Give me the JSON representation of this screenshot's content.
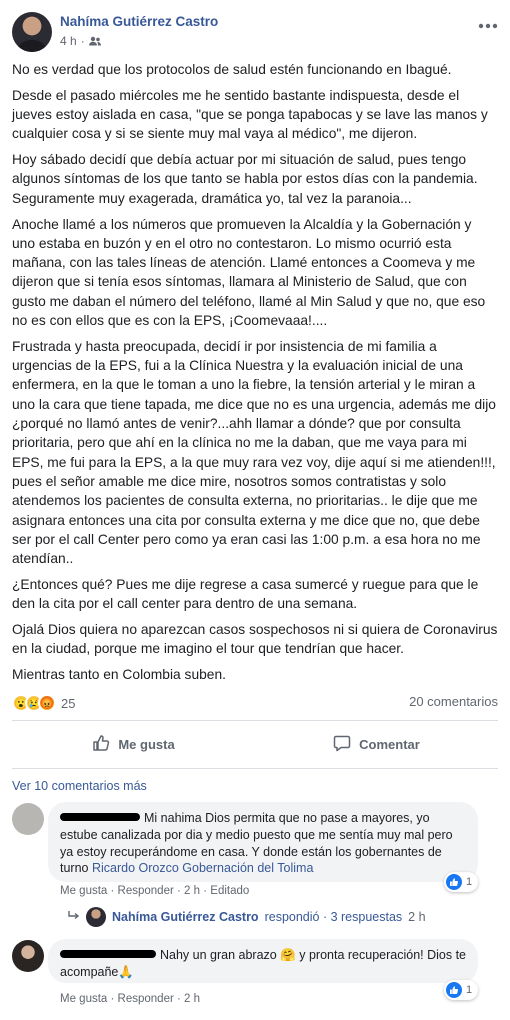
{
  "post": {
    "author": "Nahíma Gutiérrez Castro",
    "time": "4 h",
    "paragraphs": [
      "No es verdad que los protocolos de salud estén funcionando en Ibagué.",
      "Desde el pasado miércoles me he sentido bastante indispuesta, desde el jueves estoy aislada en casa, \"que se ponga tapabocas y se lave las manos y cualquier cosa y si se siente muy mal vaya al médico\", me dijeron.",
      "Hoy sábado decidí que debía actuar por mi situación de salud, pues tengo algunos síntomas de los que tanto se habla por estos días con la pandemia. Seguramente muy exagerada, dramática yo, tal vez la paranoia...",
      "Anoche llamé a los números que promueven la Alcaldía y la Gobernación y uno estaba en buzón y en el otro no contestaron. Lo mismo ocurrió esta mañana, con las tales líneas de atención. Llamé entonces a Coomeva y me dijeron que si tenía esos síntomas, llamara al Ministerio de Salud, que con gusto me daban el número del teléfono, llamé al Min Salud y que no, que eso no es con ellos que es con la EPS, ¡Coomevaaa!....",
      "Frustrada y hasta preocupada, decidí ir por insistencia de mi familia a urgencias de la EPS, fui a la Clínica Nuestra y la evaluación inicial de una enfermera, en la que le toman a uno la fiebre, la tensión arterial y le miran a uno la cara que tiene tapada, me dice que no es una urgencia, además me dijo ¿porqué no llamó antes de venir?...ahh llamar a dónde? que por consulta prioritaria, pero que ahí en la clínica no me la daban, que me vaya para mi EPS, me fui para la EPS, a la que muy rara vez voy, dije aquí si me atienden!!!, pues el señor amable me dice mire, nosotros somos contratistas y solo atendemos los pacientes de consulta externa, no prioritarias.. le dije que me asignara entonces una cita por consulta externa y me dice que no, que debe ser por el call Center pero como ya eran casi las 1:00 p.m. a esa hora no me atendían..",
      "¿Entonces qué? Pues me dije regrese a casa sumercé y ruegue para que le den la cita por el call center para dentro de una semana.",
      "Ojalá Dios quiera no aparezcan casos sospechosos ni si quiera de Coronavirus en la ciudad, porque me imagino el tour que tendrían que hacer.",
      "Mientras tanto en Colombia suben."
    ],
    "reaction_count": "25",
    "comments_count": "20 comentarios",
    "like_label": "Me gusta",
    "comment_label": "Comentar"
  },
  "comments": {
    "see_more": "Ver 10 comentarios más",
    "items": [
      {
        "text": "Mi nahima Dios permita que no pase a mayores, yo estube canalizada por dia y medio puesto que me sentía muy mal pero ya estoy recuperándome en casa. Y donde están los gobernantes de turno",
        "tags": "Ricardo Orozco Gobernación del Tolima",
        "like": "Me gusta",
        "reply": "Responder",
        "time": "2 h",
        "edited": "Editado",
        "reactions": "1"
      },
      {
        "text": "Nahy un gran abrazo 🤗 y pronta recuperación! Dios te acompañe🙏",
        "like": "Me gusta",
        "reply": "Responder",
        "time": "2 h",
        "reactions": "1"
      }
    ],
    "reply_summary": {
      "name": "Nahíma Gutiérrez Castro",
      "text": "respondió · 3 respuestas",
      "time": "2 h"
    }
  }
}
